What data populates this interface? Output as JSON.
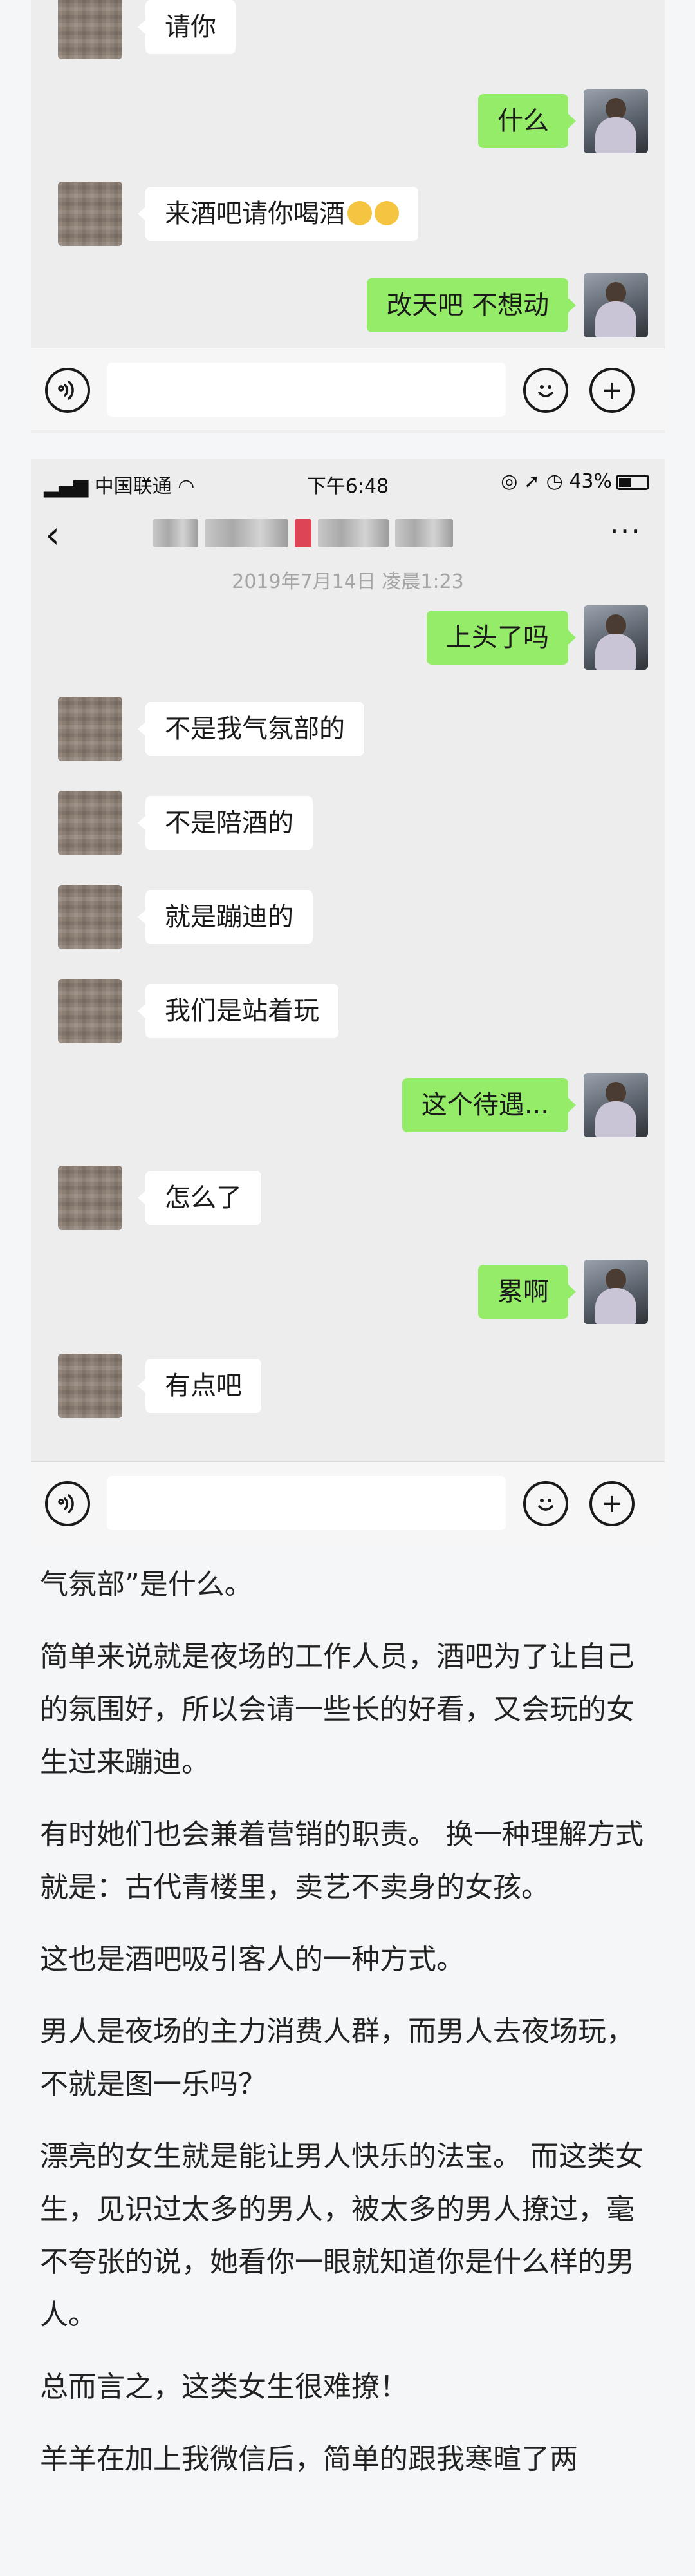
{
  "chat1": {
    "messages": [
      {
        "sender": "friend",
        "text": "请你"
      },
      {
        "sender": "me",
        "text": "什么"
      },
      {
        "sender": "friend",
        "text": "来酒吧请你喝酒"
      },
      {
        "sender": "me",
        "text": "改天吧 不想动"
      }
    ]
  },
  "chat2": {
    "status": {
      "carrier": "中国联通",
      "time": "下午6:48",
      "battery": "43%"
    },
    "timestamp": "2019年7月14日 凌晨1:23",
    "messages": [
      {
        "sender": "me",
        "text": "上头了吗"
      },
      {
        "sender": "friend",
        "text": "不是我气氛部的"
      },
      {
        "sender": "friend",
        "text": "不是陪酒的"
      },
      {
        "sender": "friend",
        "text": "就是蹦迪的"
      },
      {
        "sender": "friend",
        "text": "我们是站着玩"
      },
      {
        "sender": "me",
        "text": "这个待遇..."
      },
      {
        "sender": "friend",
        "text": "怎么了"
      },
      {
        "sender": "me",
        "text": "累啊"
      },
      {
        "sender": "friend",
        "text": "有点吧"
      }
    ]
  },
  "icons": {
    "back": "‹",
    "more": "···",
    "voice": "voice-icon",
    "emoji": "emoji-icon",
    "plus": "+"
  },
  "article": {
    "paragraphs": [
      "气氛部”是什么。",
      "简单来说就是夜场的工作人员，酒吧为了让自己的氛围好，所以会请一些长的好看，又会玩的女生过来蹦迪。",
      "有时她们也会兼着营销的职责。 换一种理解方式就是：古代青楼里，卖艺不卖身的女孩。",
      " 这也是酒吧吸引客人的一种方式。",
      " 男人是夜场的主力消费人群，而男人去夜场玩，不就是图一乐吗？",
      " 漂亮的女生就是能让男人快乐的法宝。 而这类女生，见识过太多的男人，被太多的男人撩过，毫不夸张的说，她看你一眼就知道你是什么样的男人。",
      "总而言之，这类女生很难撩！",
      " 羊羊在加上我微信后，简单的跟我寒暄了两"
    ]
  }
}
